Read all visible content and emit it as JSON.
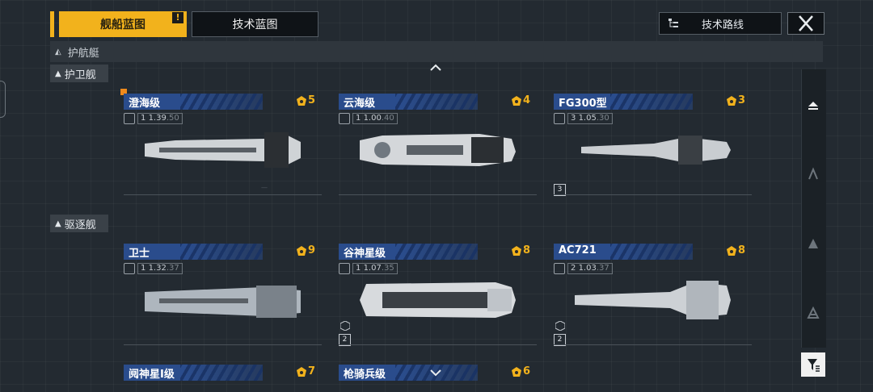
{
  "tabs": {
    "ship_blueprint": "舰船蓝图",
    "ship_blueprint_badge": "!",
    "tech_blueprint": "技术蓝图"
  },
  "header": {
    "tech_route": "技术路线"
  },
  "class_bar": {
    "label": "护航艇"
  },
  "sections": [
    {
      "label": "护卫舰"
    },
    {
      "label": "驱逐舰"
    }
  ],
  "cards": [
    {
      "name": "澄海级",
      "cost": "5",
      "stat_tier": "1",
      "stat_a": "1.39",
      "stat_b": ".50"
    },
    {
      "name": "云海级",
      "cost": "4",
      "stat_tier": "1",
      "stat_a": "1.00",
      "stat_b": ".40"
    },
    {
      "name": "FG300型",
      "cost": "3",
      "stat_tier": "3",
      "stat_a": "1.05",
      "stat_b": ".30",
      "tier_badge": "3"
    },
    {
      "name": "卫士",
      "cost": "9",
      "stat_tier": "1",
      "stat_a": "1.32",
      "stat_b": ".37"
    },
    {
      "name": "谷神星级",
      "cost": "8",
      "stat_tier": "1",
      "stat_a": "1.07",
      "stat_b": ".35",
      "tier_badge": "2"
    },
    {
      "name": "AC721",
      "cost": "8",
      "stat_tier": "2",
      "stat_a": "1.03",
      "stat_b": ".37",
      "tier_badge": "2"
    },
    {
      "name": "阋神星I级",
      "cost": "7"
    },
    {
      "name": "枪骑兵级",
      "cost": "6"
    }
  ],
  "icons": {
    "close": "close-icon",
    "tech_route": "tree-icon",
    "filter": "filter-icon",
    "cost": "resource-icon"
  },
  "colors": {
    "accent": "#f2b21c",
    "name_bar": "#2a4c8c",
    "background": "#232a31"
  }
}
